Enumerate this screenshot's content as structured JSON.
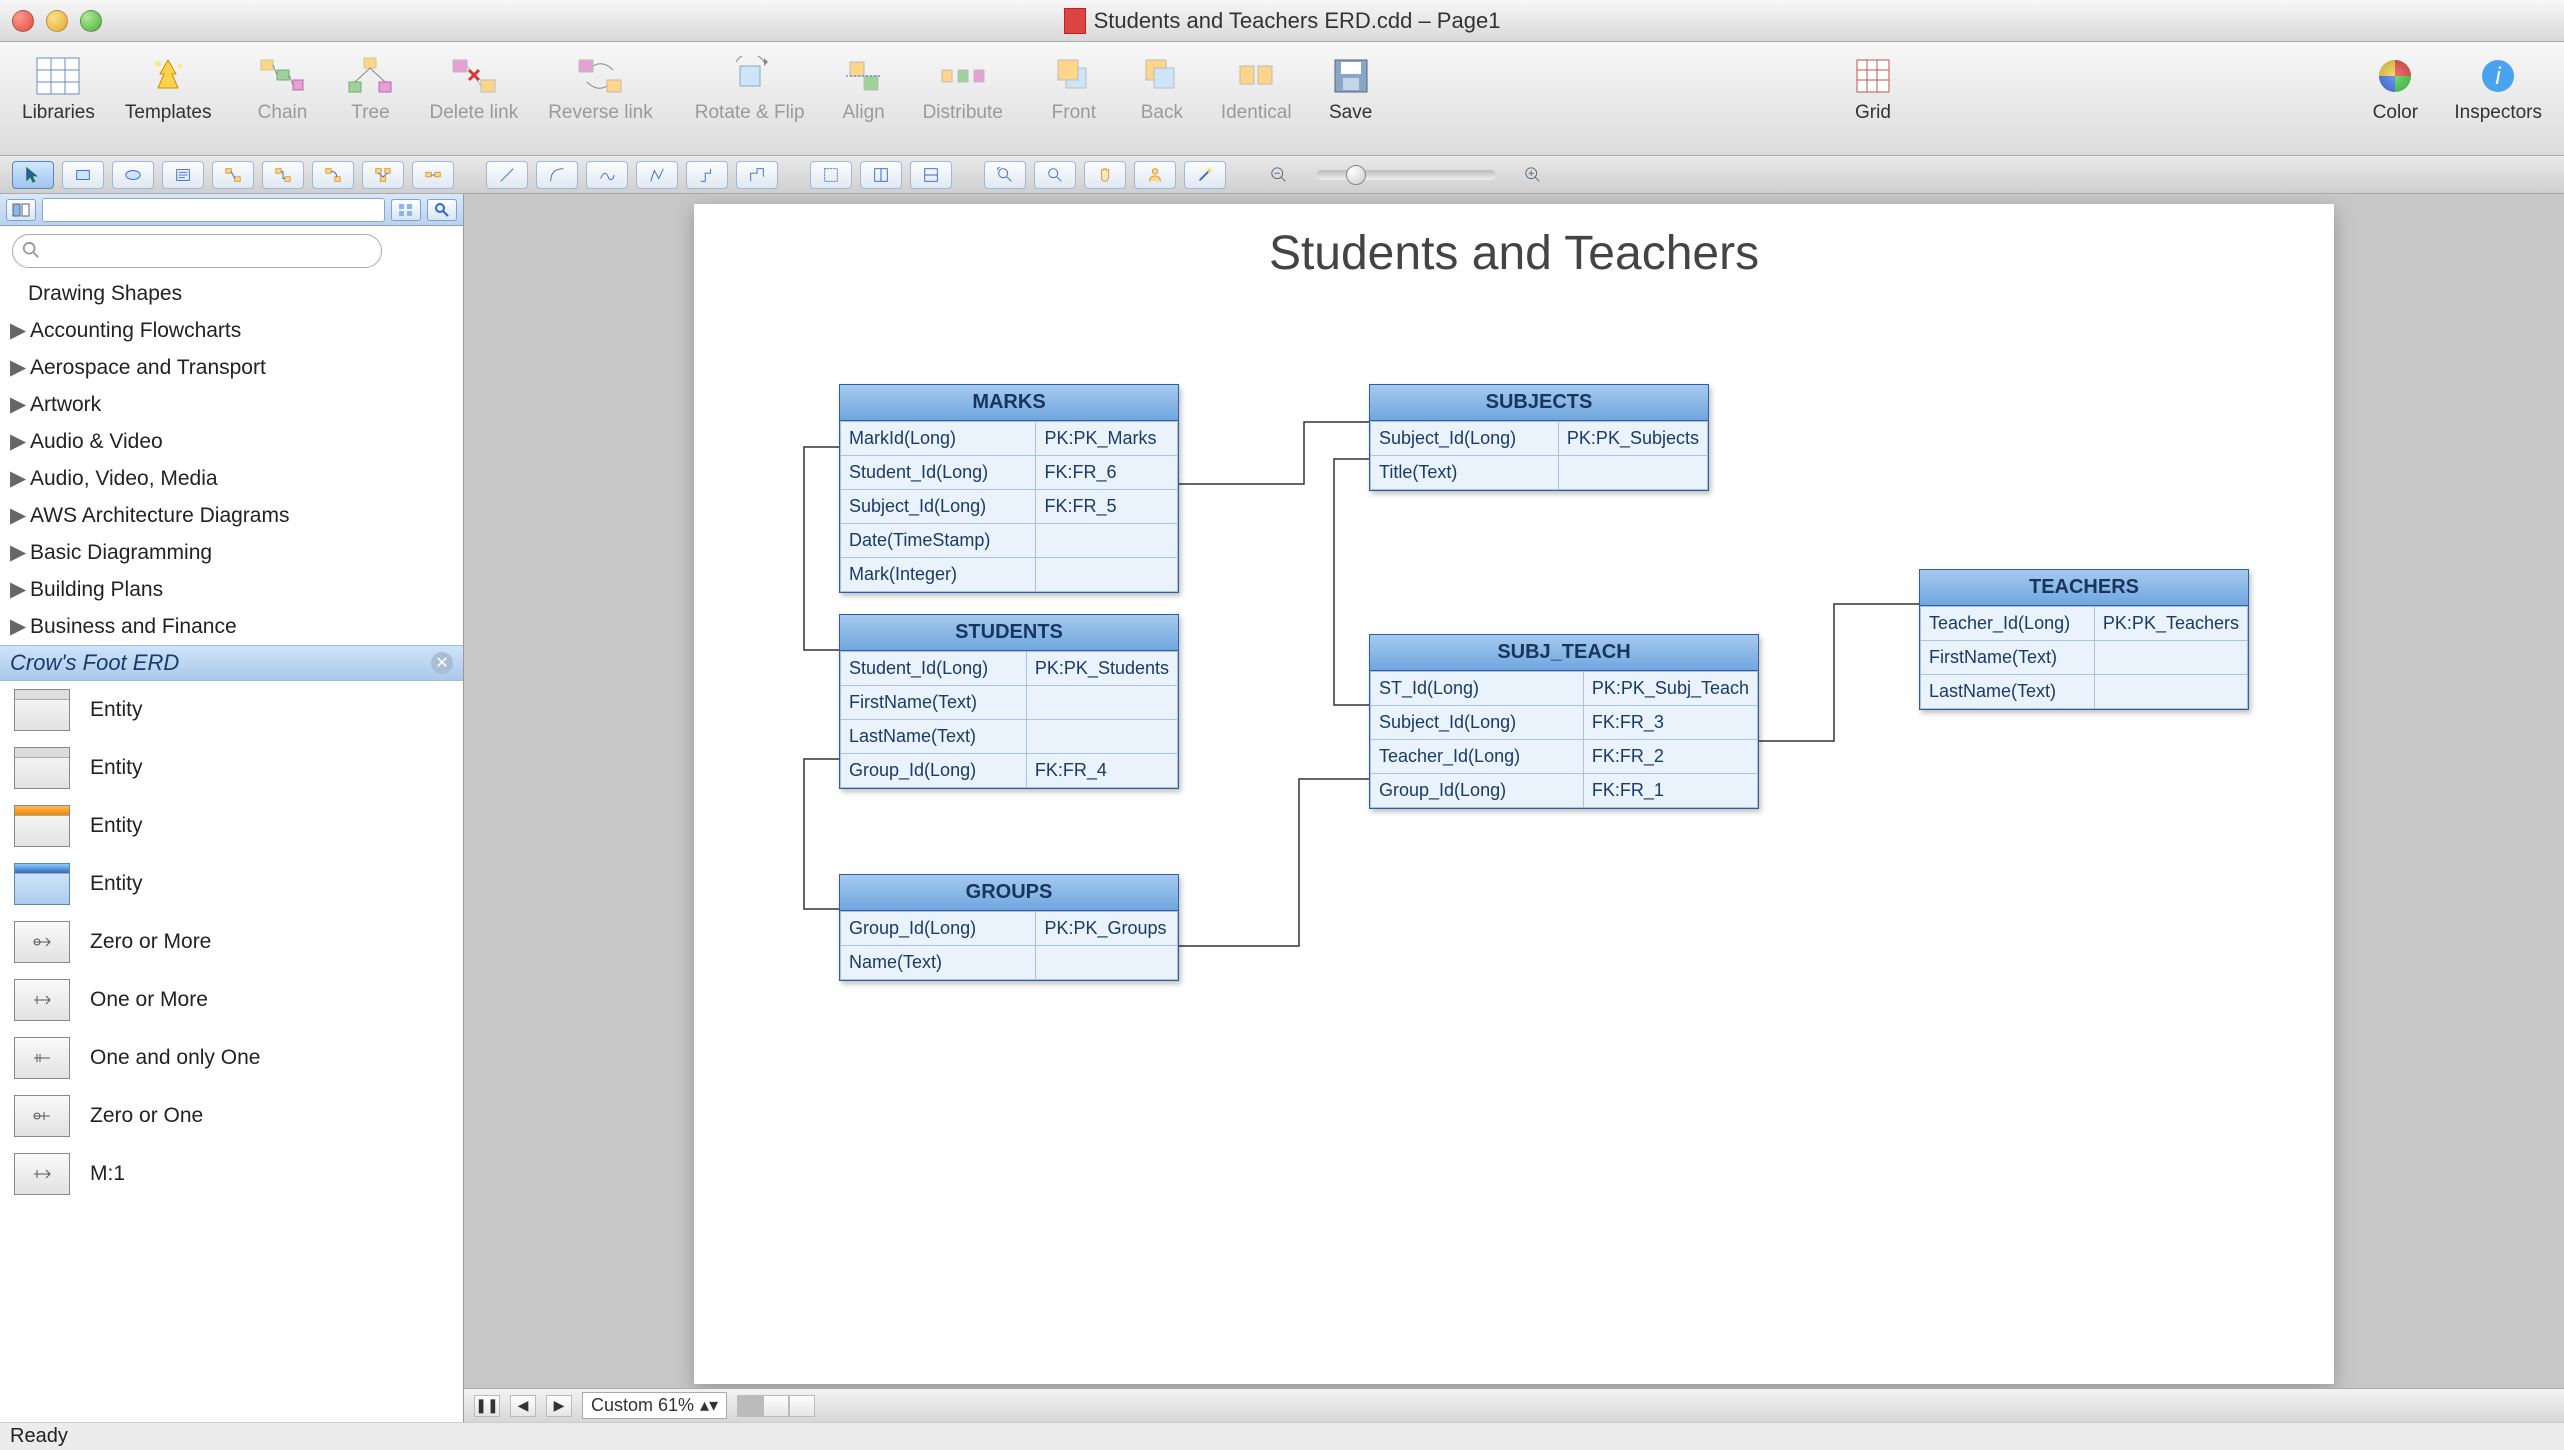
{
  "window": {
    "title": "Students and Teachers ERD.cdd – Page1"
  },
  "mainToolbar": {
    "libraries": "Libraries",
    "templates": "Templates",
    "chain": "Chain",
    "tree": "Tree",
    "deleteLink": "Delete link",
    "reverseLink": "Reverse link",
    "rotateFlip": "Rotate & Flip",
    "align": "Align",
    "distribute": "Distribute",
    "front": "Front",
    "back": "Back",
    "identical": "Identical",
    "save": "Save",
    "grid": "Grid",
    "color": "Color",
    "inspectors": "Inspectors"
  },
  "sidebar": {
    "searchPlaceholder": "",
    "heading": "Drawing Shapes",
    "categories": [
      "Accounting Flowcharts",
      "Aerospace and Transport",
      "Artwork",
      "Audio & Video",
      "Audio, Video, Media",
      "AWS Architecture Diagrams",
      "Basic Diagramming",
      "Building Plans",
      "Business and Finance"
    ],
    "selected": "Crow's Foot ERD",
    "shapes": [
      "Entity",
      "Entity",
      "Entity",
      "Entity",
      "Zero or More",
      "One or More",
      "One and only One",
      "Zero or One",
      "M:1"
    ]
  },
  "diagram": {
    "title": "Students and Teachers",
    "entities": {
      "marks": {
        "name": "MARKS",
        "rows": [
          [
            "MarkId(Long)",
            "PK:PK_Marks"
          ],
          [
            "Student_Id(Long)",
            "FK:FR_6"
          ],
          [
            "Subject_Id(Long)",
            "FK:FR_5"
          ],
          [
            "Date(TimeStamp)",
            ""
          ],
          [
            "Mark(Integer)",
            ""
          ]
        ]
      },
      "subjects": {
        "name": "SUBJECTS",
        "rows": [
          [
            "Subject_Id(Long)",
            "PK:PK_Subjects"
          ],
          [
            "Title(Text)",
            ""
          ]
        ]
      },
      "students": {
        "name": "STUDENTS",
        "rows": [
          [
            "Student_Id(Long)",
            "PK:PK_Students"
          ],
          [
            "FirstName(Text)",
            ""
          ],
          [
            "LastName(Text)",
            ""
          ],
          [
            "Group_Id(Long)",
            "FK:FR_4"
          ]
        ]
      },
      "subjTeach": {
        "name": "SUBJ_TEACH",
        "rows": [
          [
            "ST_Id(Long)",
            "PK:PK_Subj_Teach"
          ],
          [
            "Subject_Id(Long)",
            "FK:FR_3"
          ],
          [
            "Teacher_Id(Long)",
            "FK:FR_2"
          ],
          [
            "Group_Id(Long)",
            "FK:FR_1"
          ]
        ]
      },
      "teachers": {
        "name": "TEACHERS",
        "rows": [
          [
            "Teacher_Id(Long)",
            "PK:PK_Teachers"
          ],
          [
            "FirstName(Text)",
            ""
          ],
          [
            "LastName(Text)",
            ""
          ]
        ]
      },
      "groups": {
        "name": "GROUPS",
        "rows": [
          [
            "Group_Id(Long)",
            "PK:PK_Groups"
          ],
          [
            "Name(Text)",
            ""
          ]
        ]
      }
    }
  },
  "bottom": {
    "zoom": "Custom 61%"
  },
  "status": {
    "text": "Ready"
  }
}
